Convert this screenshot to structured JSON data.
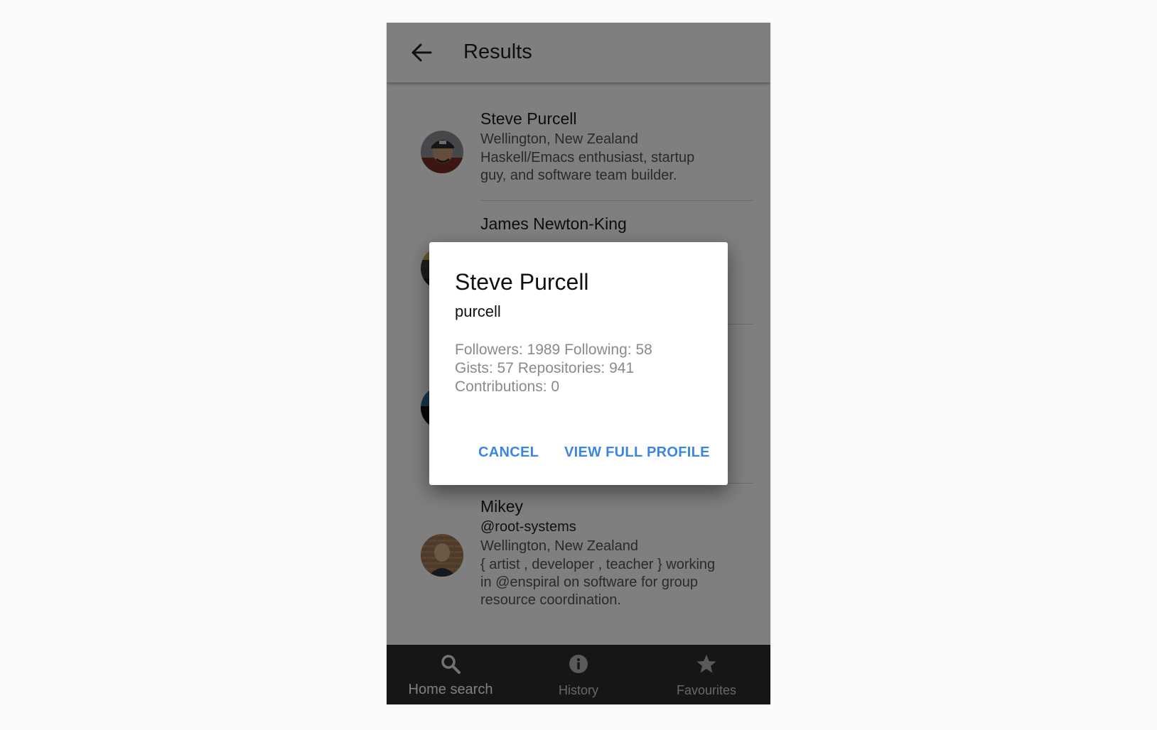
{
  "appbar": {
    "title": "Results",
    "back_icon": "arrow-left-icon"
  },
  "results": [
    {
      "name": "Steve Purcell",
      "location": "Wellington, New Zealand",
      "bio_line1": "Haskell/Emacs enthusiast, startup",
      "bio_line2": "guy, and software team builder."
    },
    {
      "name": "James Newton-King"
    },
    {
      "name": "Mikey",
      "login": "@root-systems",
      "location": "Wellington, New Zealand",
      "bio_line1": "{ artist , developer , teacher } working",
      "bio_line2": "in @enspiral on software for group",
      "bio_line3": "resource coordination."
    }
  ],
  "dialog": {
    "title": "Steve Purcell",
    "login": "purcell",
    "stats_line1": "Followers: 1989 Following: 58",
    "stats_line2": "Gists: 57 Repositories: 941",
    "stats_line3": "Contributions: 0",
    "cancel_label": "CANCEL",
    "view_profile_label": "VIEW FULL PROFILE"
  },
  "bottom_nav": [
    {
      "label": "Home search",
      "icon": "search-icon",
      "active": true
    },
    {
      "label": "History",
      "icon": "info-icon",
      "active": false
    },
    {
      "label": "Favourites",
      "icon": "star-icon",
      "active": false
    }
  ],
  "colors": {
    "accent": "#3b87e0",
    "nav_background": "#2d2d2d",
    "scrim": "rgba(0,0,0,0.5)"
  }
}
